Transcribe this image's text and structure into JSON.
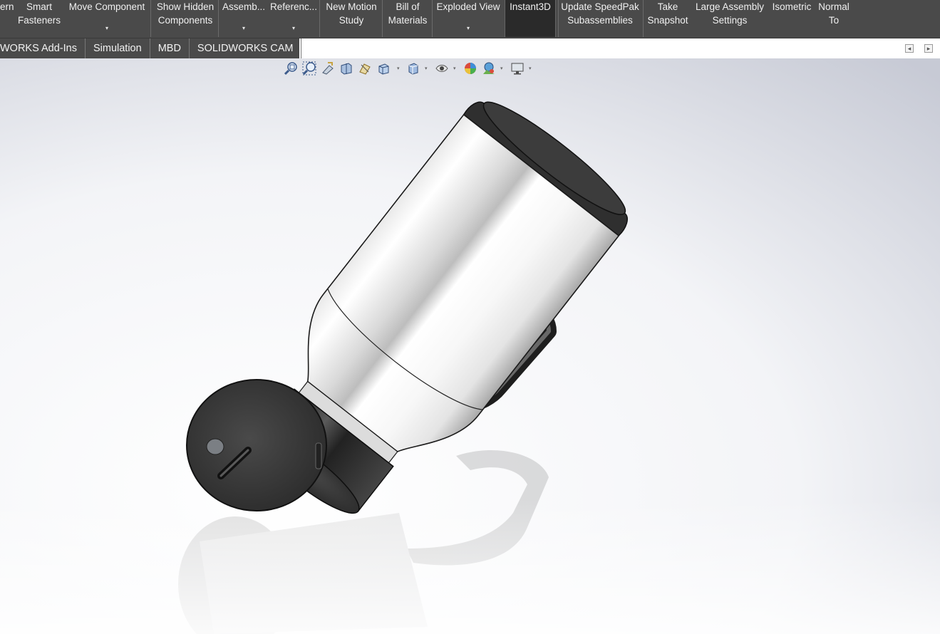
{
  "ribbon": {
    "items": [
      {
        "lines": [
          "ern"
        ],
        "dropdown": false
      },
      {
        "lines": [
          "Smart",
          "Fasteners"
        ],
        "dropdown": false
      },
      {
        "lines": [
          "Move Component"
        ],
        "dropdown": true
      },
      {
        "lines": [
          "Show Hidden",
          "Components"
        ],
        "dropdown": false
      },
      {
        "lines": [
          "Assemb..."
        ],
        "dropdown": true
      },
      {
        "lines": [
          "Referenc..."
        ],
        "dropdown": true
      },
      {
        "lines": [
          "New Motion",
          "Study"
        ],
        "dropdown": false
      },
      {
        "lines": [
          "Bill of",
          "Materials"
        ],
        "dropdown": false
      },
      {
        "lines": [
          "Exploded View"
        ],
        "dropdown": true
      },
      {
        "lines": [
          "Instant3D"
        ],
        "dropdown": false,
        "active": true
      },
      {
        "lines": [
          "Update SpeedPak",
          "Subassemblies"
        ],
        "dropdown": false
      },
      {
        "lines": [
          "Take",
          "Snapshot"
        ],
        "dropdown": false
      },
      {
        "lines": [
          "Large Assembly",
          "Settings"
        ],
        "dropdown": false
      },
      {
        "lines": [
          "Isometric"
        ],
        "dropdown": false
      },
      {
        "lines": [
          "Normal",
          "To"
        ],
        "dropdown": false
      }
    ],
    "dropdown_glyph": "▾"
  },
  "tabs": [
    "WORKS Add-Ins",
    "Simulation",
    "MBD",
    "SOLIDWORKS CAM"
  ],
  "corner_buttons": [
    {
      "icon": "collapse-left-icon",
      "glyph": "◂"
    },
    {
      "icon": "collapse-right-icon",
      "glyph": "▸"
    }
  ],
  "hud_toolbar": [
    {
      "icon": "zoom-to-fit-icon",
      "dropdown": false
    },
    {
      "icon": "zoom-to-area-icon",
      "dropdown": false
    },
    {
      "icon": "previous-view-icon",
      "dropdown": false
    },
    {
      "icon": "section-view-icon",
      "dropdown": false
    },
    {
      "icon": "dynamic-annotation-views-icon",
      "dropdown": false
    },
    {
      "icon": "view-orientation-icon",
      "dropdown": true
    },
    {
      "icon": "display-style-icon",
      "dropdown": true
    },
    {
      "icon": "hide-show-items-icon",
      "dropdown": true
    },
    {
      "icon": "edit-appearance-icon",
      "dropdown": false
    },
    {
      "icon": "apply-scene-icon",
      "dropdown": true
    },
    {
      "icon": "view-settings-icon",
      "dropdown": true
    }
  ],
  "colors": {
    "ribbon_bg": "#4a4a4a",
    "ribbon_text": "#f0f0f0",
    "active_bg": "#2a2a2a",
    "background_gradient_start": "#ffffff",
    "background_gradient_end": "#c9ccd6",
    "metal_light": "#f4f4f4",
    "metal_dark": "#3a3a3a"
  }
}
